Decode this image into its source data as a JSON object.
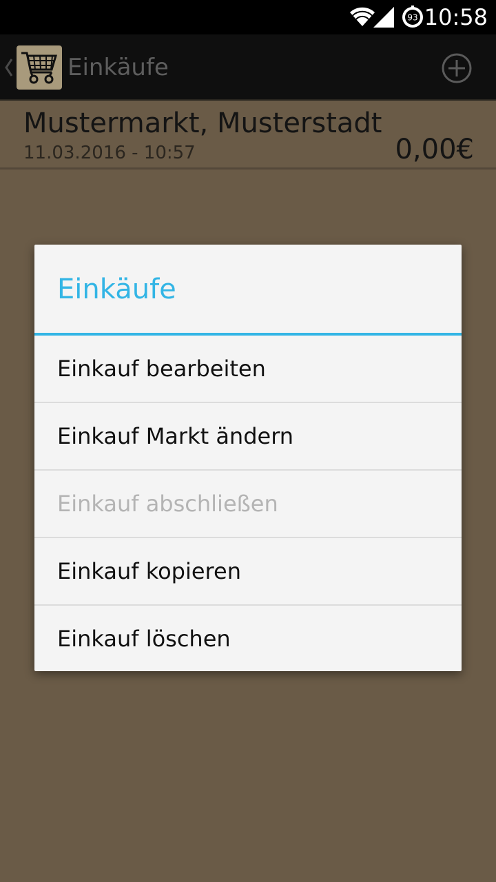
{
  "status_bar": {
    "time": "10:58",
    "battery_level": "93"
  },
  "action_bar": {
    "title": "Einkäufe"
  },
  "purchase": {
    "market": "Mustermarkt, Musterstadt",
    "datetime": "11.03.2016 - 10:57",
    "total": "0,00€"
  },
  "dialog": {
    "title": "Einkäufe",
    "accent_color": "#33b5e5",
    "items": [
      {
        "label": "Einkauf bearbeiten",
        "enabled": true
      },
      {
        "label": "Einkauf Markt ändern",
        "enabled": true
      },
      {
        "label": "Einkauf abschließen",
        "enabled": false
      },
      {
        "label": "Einkauf kopieren",
        "enabled": true
      },
      {
        "label": "Einkauf löschen",
        "enabled": true
      }
    ]
  },
  "colors": {
    "background_dimmed": "#6a5b47",
    "action_bar": "#0f0f0f",
    "dialog_background": "#f4f4f4"
  }
}
